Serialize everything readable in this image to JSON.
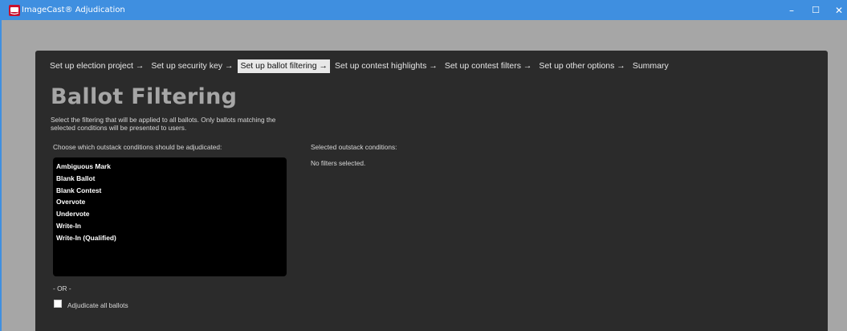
{
  "window": {
    "title": "ImageCast® Adjudication",
    "controls": {
      "minimize": "–",
      "maximize": "☐",
      "close": "✕"
    },
    "accent_color": "#3f8fe0"
  },
  "wizard": {
    "steps": [
      {
        "label": "Set up election project →",
        "active": false
      },
      {
        "label": "Set up security key →",
        "active": false
      },
      {
        "label": "Set up ballot filtering →",
        "active": true
      },
      {
        "label": "Set up contest highlights →",
        "active": false
      },
      {
        "label": "Set up contest filters →",
        "active": false
      },
      {
        "label": "Set up other options →",
        "active": false
      },
      {
        "label": "Summary",
        "active": false
      }
    ]
  },
  "page": {
    "title": "Ballot Filtering",
    "description": "Select the filtering that will be applied to all ballots. Only ballots matching the selected conditions will be presented to users."
  },
  "conditions": {
    "label": "Choose which outstack conditions should be adjudicated:",
    "items": [
      "Ambiguous Mark",
      "Blank Ballot",
      "Blank Contest",
      "Overvote",
      "Undervote",
      "Write-In",
      "Write-In (Qualified)"
    ]
  },
  "selected": {
    "label": "Selected outstack conditions:",
    "empty_text": "No filters selected."
  },
  "alternative": {
    "or_label": "- OR -",
    "adjudicate_all_label": "Adjudicate all ballots",
    "adjudicate_all_checked": false
  }
}
